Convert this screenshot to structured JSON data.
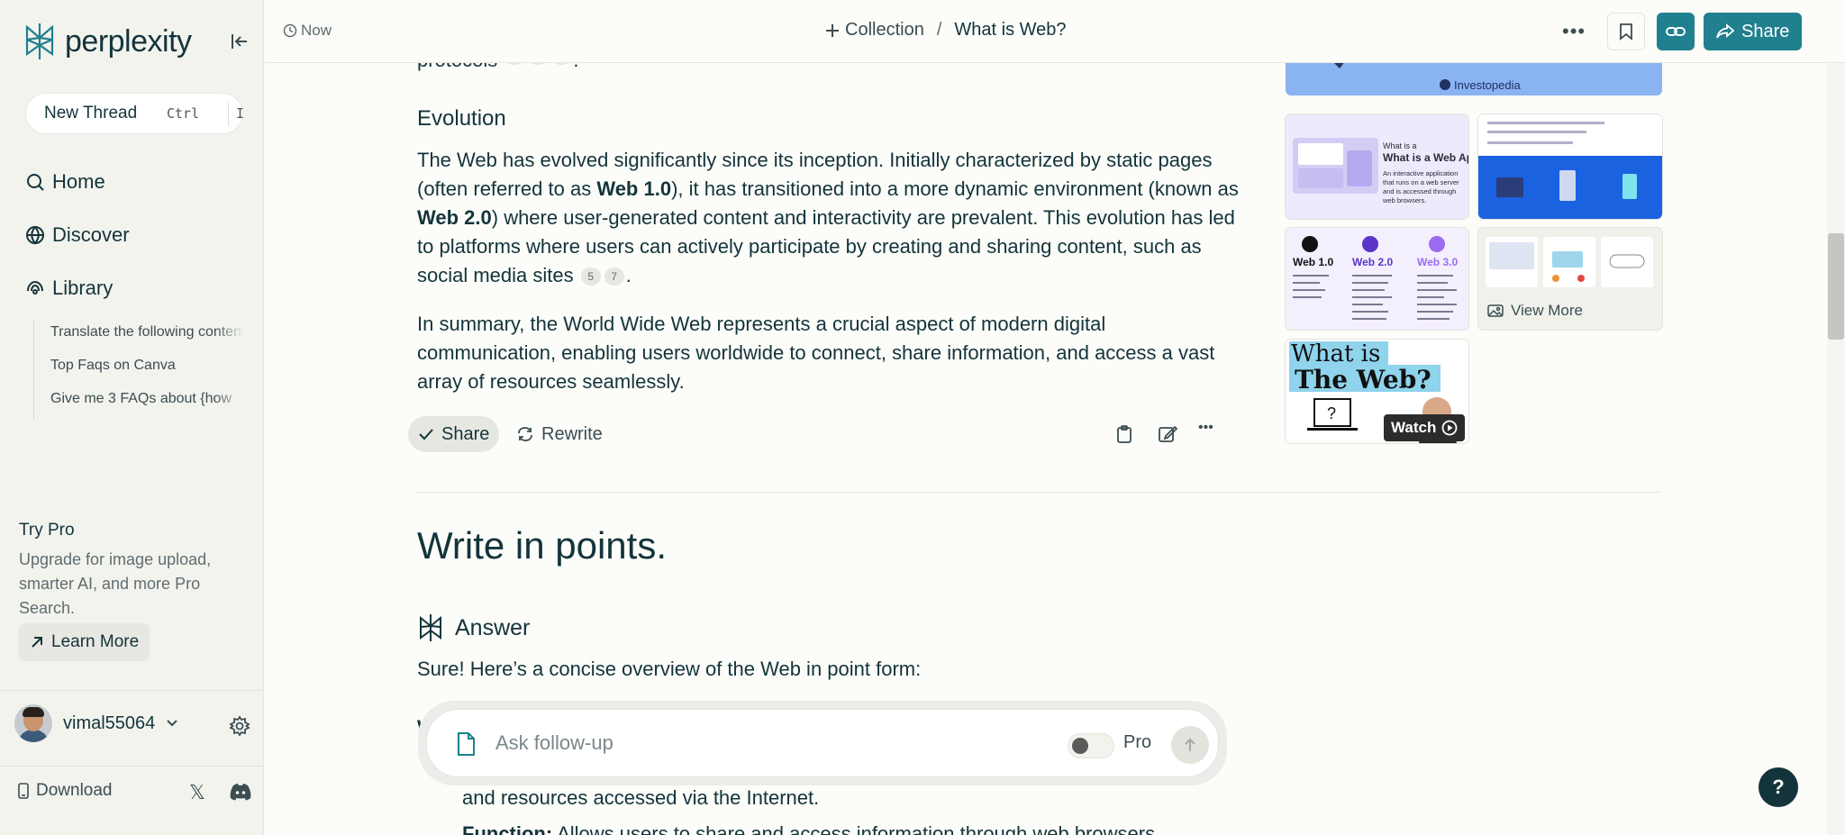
{
  "app": {
    "name": "perplexity"
  },
  "sidebar": {
    "new_thread": {
      "label": "New Thread",
      "shortcut_mod": "Ctrl",
      "shortcut_key": "I"
    },
    "nav": [
      {
        "label": "Home",
        "icon": "search-icon"
      },
      {
        "label": "Discover",
        "icon": "globe-icon"
      },
      {
        "label": "Library",
        "icon": "library-icon"
      }
    ],
    "library_items": [
      "Translate the following content",
      "Top Faqs on Canva",
      "Give me 3 FAQs about {how"
    ],
    "try_pro": {
      "title": "Try Pro",
      "description": "Upgrade for image upload, smarter AI, and more Pro Search.",
      "button": "Learn More"
    },
    "user": {
      "name": "vimal55064"
    },
    "download": "Download"
  },
  "header": {
    "time": "Now",
    "collection": "Collection",
    "separator": "/",
    "thread_title": "What is Web?",
    "share": "Share"
  },
  "content": {
    "partial_top_text": "protocols",
    "evolution_heading": "Evolution",
    "evolution_p": {
      "t1": "The Web has evolved significantly since its inception. Initially characterized by static pages (often referred to as ",
      "b1": "Web 1.0",
      "t2": "), it has transitioned into a more dynamic environment (known as ",
      "b2": "Web 2.0",
      "t3": ") where user-generated content and interactivity are prevalent. This evolution has led to platforms where users can actively participate by creating and sharing content, such as social media sites",
      "cite1": "5",
      "cite2": "7",
      "t4": "."
    },
    "summary_p": "In summary, the World Wide Web represents a crucial aspect of modern digital communication, enabling users worldwide to connect, share information, and access a vast array of resources seamlessly.",
    "actions": {
      "share": "Share",
      "rewrite": "Rewrite"
    },
    "question": "Write in points.",
    "answer_heading": "Answer",
    "answer_intro": "Sure! Here’s a concise overview of the Web in point form:",
    "under_line1": "and resources accessed via the Internet.",
    "under_line2_bold": "Function:",
    "under_line2": " Allows users to share and access information through web browsers."
  },
  "images": {
    "big_source": "Investopedia",
    "tile1_title": "What is a Web Application",
    "tile1_body": "An interactive application that runs on a web server and is accessed through web browsers.",
    "tile3_cols": [
      "Web 1.0",
      "Web 2.0",
      "Web 3.0"
    ],
    "view_more": "View More",
    "tile5_line1": "What is",
    "tile5_line2": "The Web?",
    "watch": "Watch"
  },
  "followup": {
    "placeholder": "Ask follow-up",
    "pro_label": "Pro"
  },
  "colors": {
    "accent": "#20808d",
    "text": "#13343b",
    "background": "#fcfcf9"
  }
}
